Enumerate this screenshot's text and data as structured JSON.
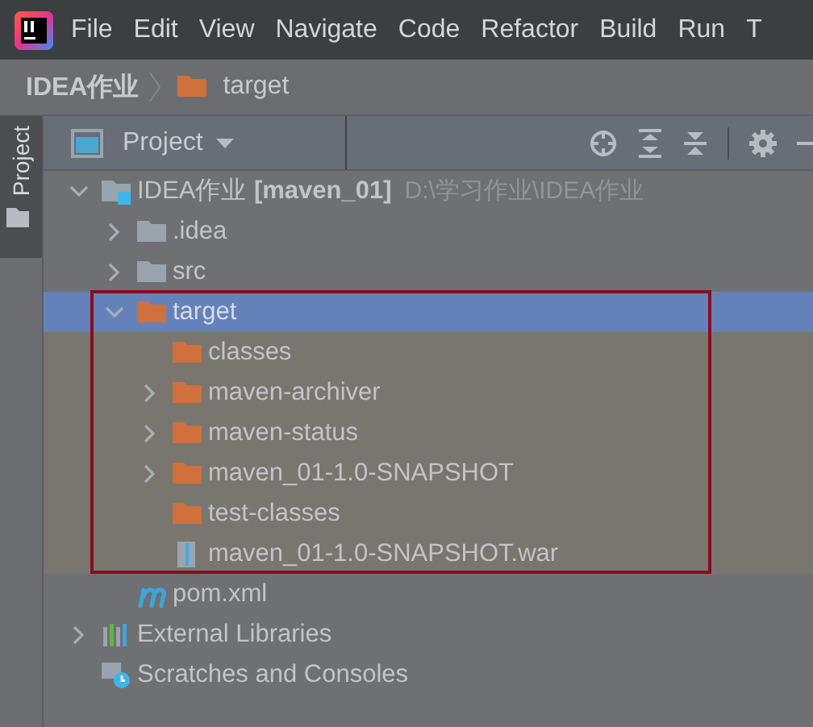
{
  "menu": [
    "File",
    "Edit",
    "View",
    "Navigate",
    "Code",
    "Refactor",
    "Build",
    "Run",
    "T"
  ],
  "breadcrumb": [
    {
      "label": "IDEA作业",
      "kind": "project"
    },
    {
      "label": "target",
      "kind": "excluded"
    }
  ],
  "side_tabs": [
    {
      "label": "Project",
      "selected": true
    }
  ],
  "tool_window": {
    "title": "Project"
  },
  "tree": [
    {
      "label": "IDEA作业 **[maven_01]**",
      "path": "D:\\学习作业\\IDEA作业",
      "kind": "module",
      "expanded": true,
      "selected": false,
      "children": [
        {
          "label": ".idea",
          "kind": "folder",
          "expanded": false,
          "selected": false
        },
        {
          "label": "src",
          "kind": "folder",
          "expanded": false,
          "selected": false
        },
        {
          "label": "target",
          "kind": "excluded",
          "expanded": true,
          "selected": true,
          "outlined": true,
          "children": [
            {
              "label": "classes",
              "kind": "excluded",
              "selected": false
            },
            {
              "label": "maven-archiver",
              "kind": "excluded",
              "expanded": false,
              "selected": false
            },
            {
              "label": "maven-status",
              "kind": "excluded",
              "expanded": false,
              "selected": false
            },
            {
              "label": "maven_01-1.0-SNAPSHOT",
              "kind": "excluded",
              "expanded": false,
              "selected": false
            },
            {
              "label": "test-classes",
              "kind": "excluded",
              "selected": false
            },
            {
              "label": "maven_01-1.0-SNAPSHOT.war",
              "kind": "archive",
              "selected": false
            }
          ]
        },
        {
          "label": "pom.xml",
          "kind": "maven",
          "selected": false
        }
      ]
    },
    {
      "label": "External Libraries",
      "kind": "libraries",
      "expanded": false,
      "selected": false
    },
    {
      "label": "Scratches and Consoles",
      "kind": "scratches",
      "selected": false
    }
  ]
}
